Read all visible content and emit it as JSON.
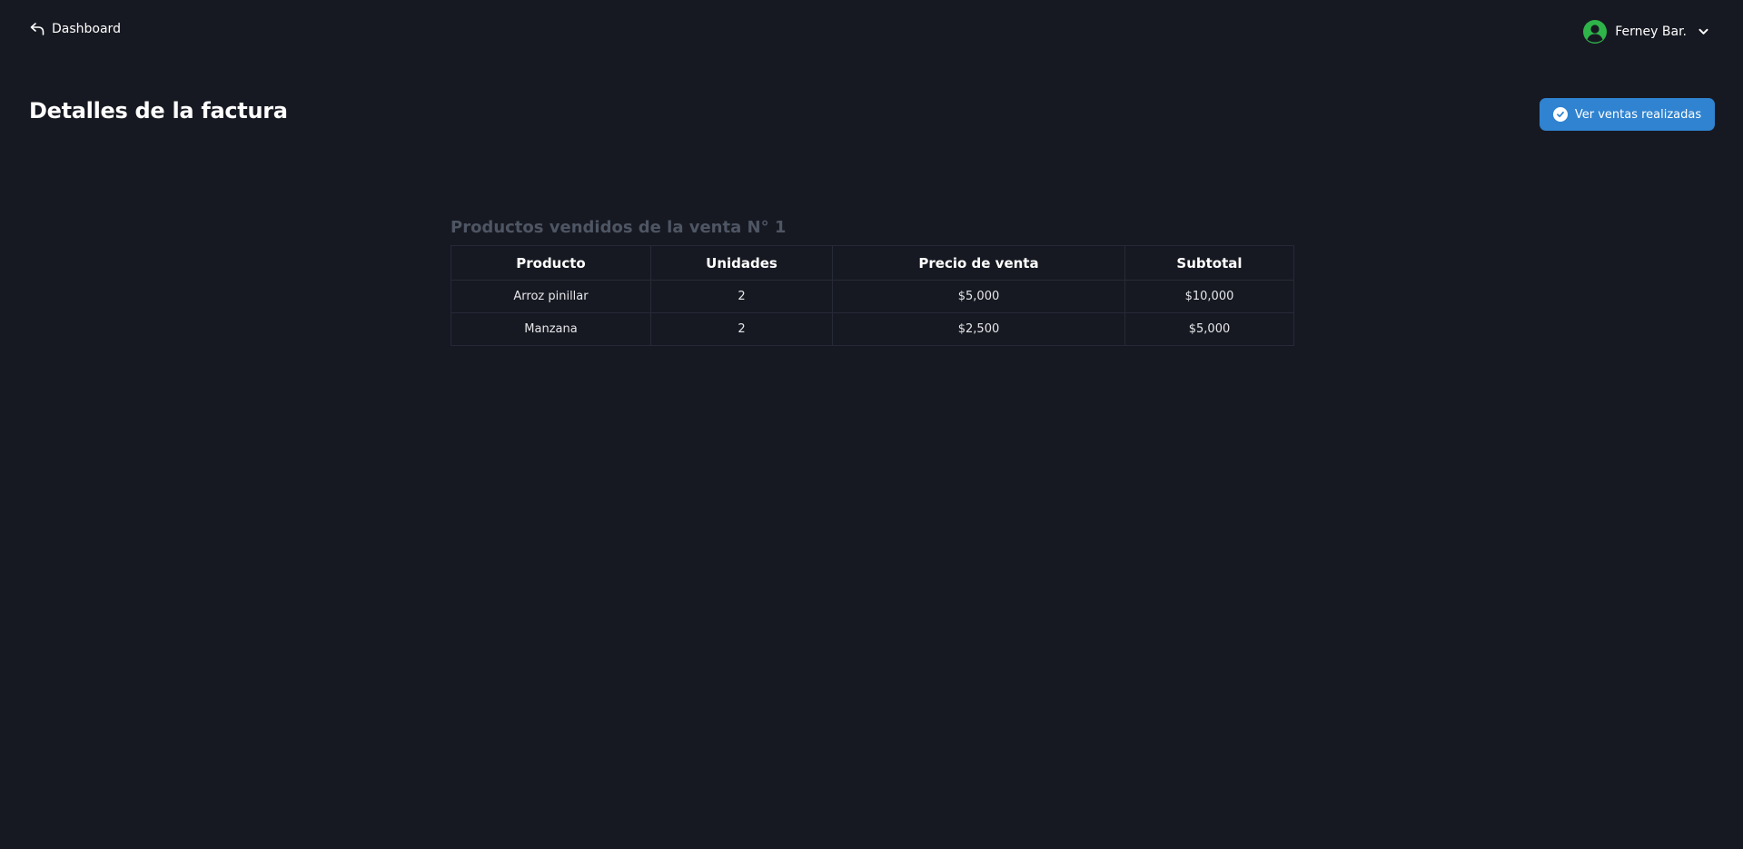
{
  "nav": {
    "back_label": "Dashboard",
    "back_icon": "arrow-back-icon"
  },
  "user": {
    "name": "Ferney Bar.",
    "avatar_icon": "user-circle-icon",
    "avatar_color": "#2fb44a",
    "menu_icon": "chevron-down-icon"
  },
  "header": {
    "title": "Detalles de la factura",
    "action_label": "Ver ventas realizadas",
    "action_icon": "check-circle-icon",
    "action_color": "#2f83d0"
  },
  "invoice": {
    "section_title": "Productos vendidos de la venta N° 1",
    "columns": [
      "Producto",
      "Unidades",
      "Precio de venta",
      "Subtotal"
    ],
    "rows": [
      [
        "Arroz pinillar",
        "2",
        "$5,000",
        "$10,000"
      ],
      [
        "Manzana",
        "2",
        "$2,500",
        "$5,000"
      ]
    ]
  },
  "theme": {
    "background": "#171922",
    "muted_text": "#4e5563"
  }
}
